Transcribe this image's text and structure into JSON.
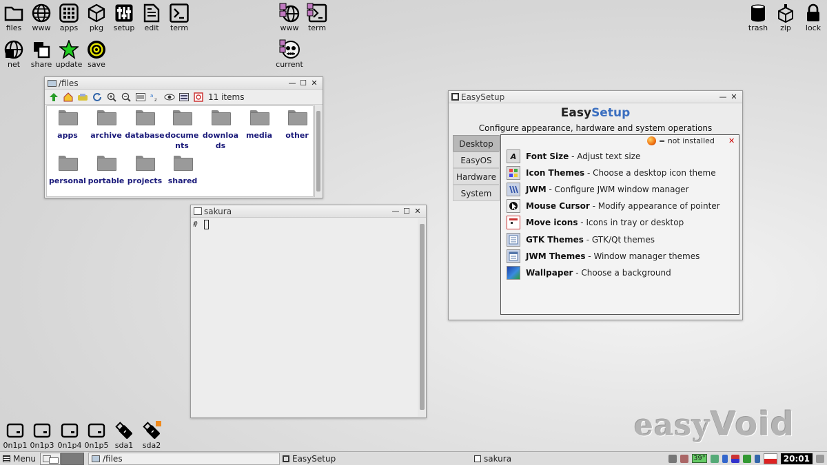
{
  "desktop": {
    "top_left_icons": [
      {
        "label": "files",
        "icon": "folder-icon"
      },
      {
        "label": "www",
        "icon": "globe-icon"
      },
      {
        "label": "apps",
        "icon": "apps-grid-icon"
      },
      {
        "label": "pkg",
        "icon": "package-icon"
      },
      {
        "label": "setup",
        "icon": "sliders-icon"
      },
      {
        "label": "edit",
        "icon": "document-icon"
      },
      {
        "label": "term",
        "icon": "terminal-icon"
      }
    ],
    "second_row_icons": [
      {
        "label": "net",
        "icon": "network-icon"
      },
      {
        "label": "share",
        "icon": "share-icon"
      },
      {
        "label": "update",
        "icon": "star-icon"
      },
      {
        "label": "save",
        "icon": "target-icon"
      }
    ],
    "center_icons": [
      {
        "label": "www",
        "icon": "globe-icon"
      },
      {
        "label": "term",
        "icon": "terminal-icon"
      },
      {
        "label": "current",
        "icon": "skull-icon"
      }
    ],
    "top_right_icons": [
      {
        "label": "trash",
        "icon": "trash-icon"
      },
      {
        "label": "zip",
        "icon": "zip-icon"
      },
      {
        "label": "lock",
        "icon": "lock-icon"
      }
    ],
    "drive_icons": [
      {
        "label": "0n1p1",
        "icon": "drive-icon"
      },
      {
        "label": "0n1p3",
        "icon": "drive-icon"
      },
      {
        "label": "0n1p4",
        "icon": "drive-icon"
      },
      {
        "label": "0n1p5",
        "icon": "drive-icon"
      },
      {
        "label": "sda1",
        "icon": "usb-icon"
      },
      {
        "label": "sda2",
        "icon": "usb-icon"
      }
    ],
    "watermark": {
      "part1": "easy",
      "part2": "Void"
    }
  },
  "files_window": {
    "title": "/files",
    "item_count": "11 items",
    "items": [
      "apps",
      "archive",
      "database",
      "documents",
      "downloads",
      "media",
      "other",
      "personal",
      "portable",
      "projects",
      "shared"
    ]
  },
  "sakura_window": {
    "title": "sakura",
    "prompt": "#"
  },
  "easysetup_window": {
    "title": "EasySetup",
    "heading_part1": "Easy",
    "heading_part2": "Setup",
    "subtitle": "Configure appearance, hardware and system operations",
    "tabs": [
      "Desktop",
      "EasyOS",
      "Hardware",
      "System"
    ],
    "legend": "= not installed",
    "items": [
      {
        "name": "Font Size",
        "desc": " - Adjust text size"
      },
      {
        "name": "Icon Themes",
        "desc": " - Choose a desktop icon theme"
      },
      {
        "name": "JWM",
        "desc": " - Configure JWM window manager"
      },
      {
        "name": "Mouse Cursor",
        "desc": " - Modify appearance of pointer"
      },
      {
        "name": "Move icons",
        "desc": " - Icons in tray or desktop"
      },
      {
        "name": "GTK Themes",
        "desc": " - GTK/Qt themes"
      },
      {
        "name": "JWM Themes",
        "desc": " - Window manager themes"
      },
      {
        "name": "Wallpaper",
        "desc": " - Choose a background"
      }
    ]
  },
  "taskbar": {
    "menu_label": "Menu",
    "tasks": [
      "/files",
      "EasySetup",
      "sakura"
    ],
    "temperature": "39°",
    "clock": "20:01"
  }
}
